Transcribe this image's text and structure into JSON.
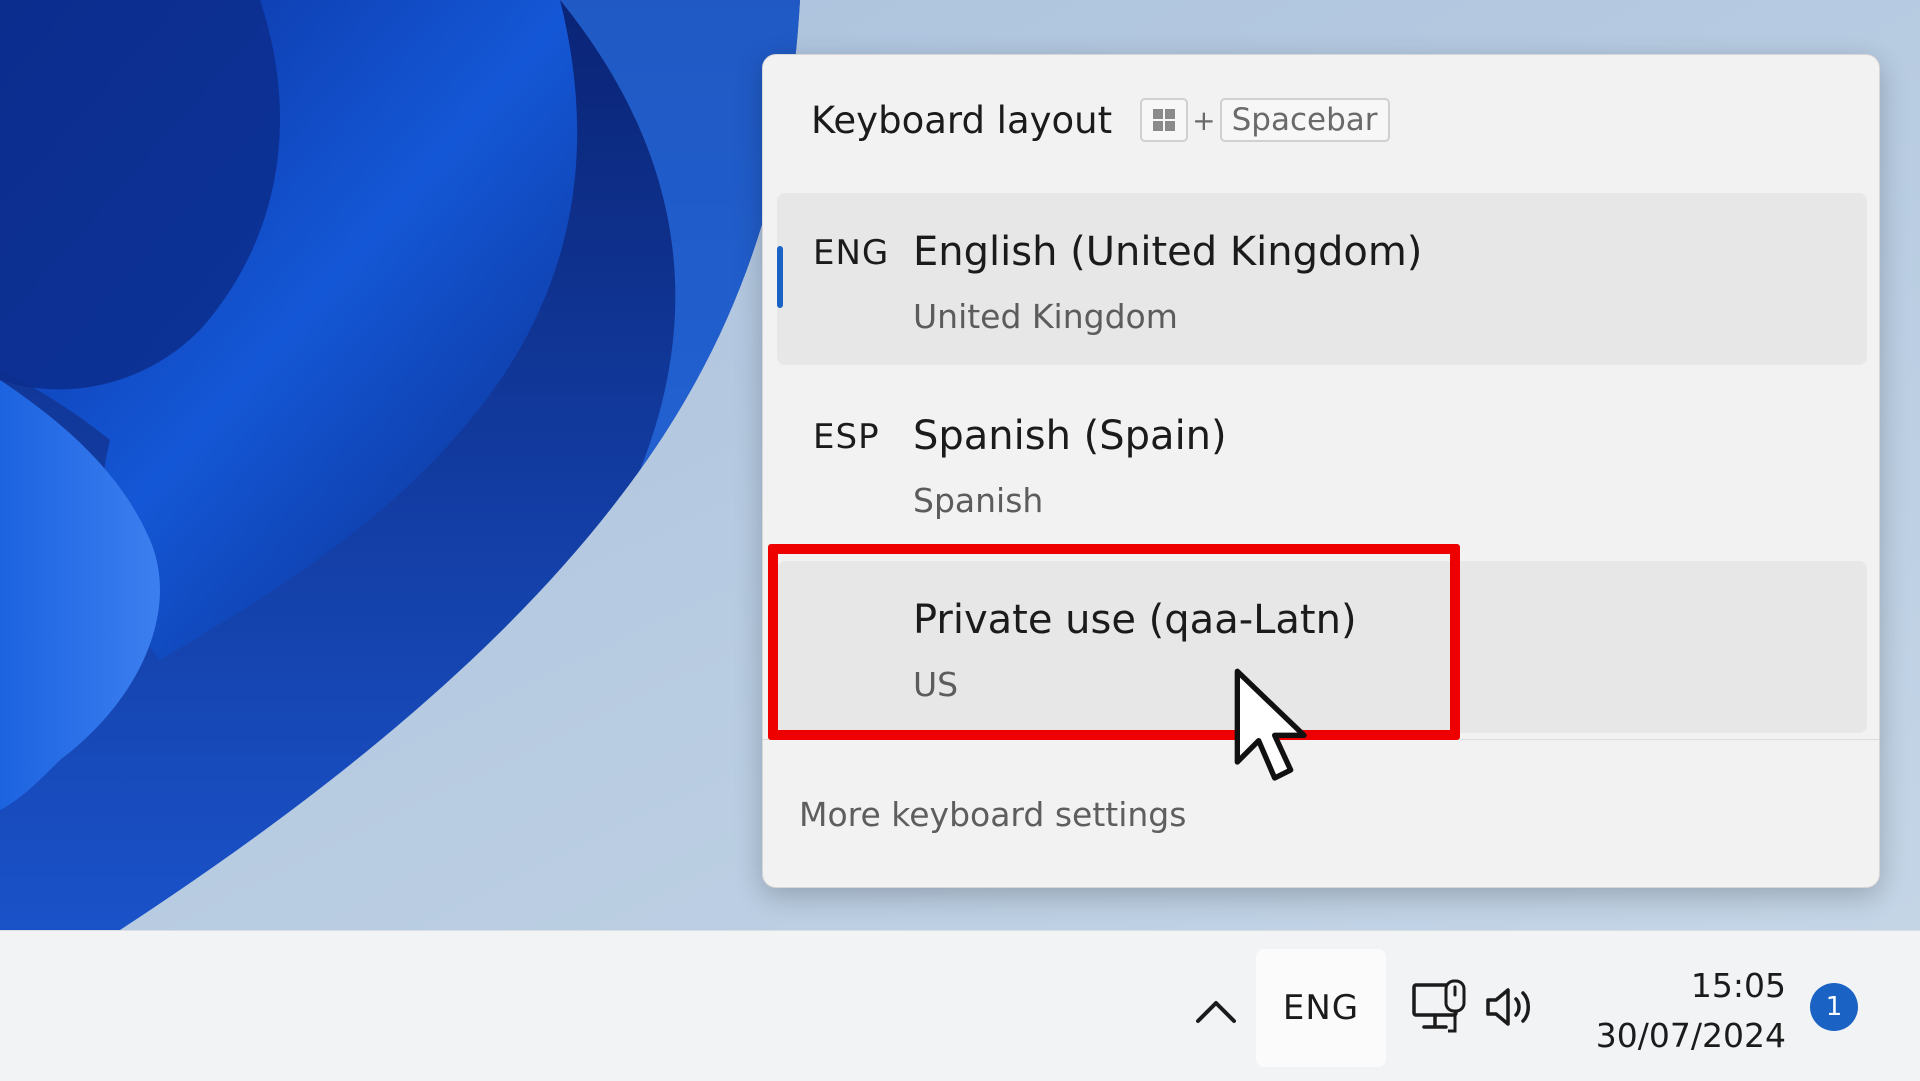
{
  "flyout": {
    "title": "Keyboard layout",
    "shortcut_plus": "+",
    "shortcut_key": "Spacebar",
    "items": [
      {
        "code": "ENG",
        "name": "English (United Kingdom)",
        "sub": "United Kingdom",
        "selected": true
      },
      {
        "code": "ESP",
        "name": "Spanish (Spain)",
        "sub": "Spanish",
        "selected": false
      },
      {
        "code": "",
        "name": "Private use (qaa-Latn)",
        "sub": "US",
        "selected": false
      }
    ],
    "more_settings": "More keyboard settings"
  },
  "taskbar": {
    "language": "ENG",
    "time": "15:05",
    "date": "30/07/2024",
    "notification_count": "1"
  },
  "colors": {
    "accent": "#1a63c4",
    "highlight": "#ee0000"
  },
  "icons": [
    "windows-key-icon",
    "chevron-up-icon",
    "network-icon",
    "volume-icon",
    "mouse-cursor-icon"
  ]
}
